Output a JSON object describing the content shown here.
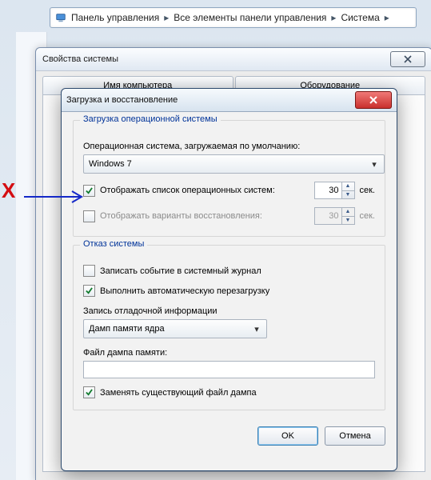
{
  "breadcrumb": {
    "segment1": "Панель управления",
    "segment2": "Все элементы панели управления",
    "segment3": "Система"
  },
  "props_window": {
    "title": "Свойства системы",
    "tabs": [
      "Имя компьютера",
      "Оборудование"
    ]
  },
  "dialog": {
    "title": "Загрузка и восстановление",
    "ok": "OK",
    "cancel": "Отмена",
    "group_boot": {
      "legend": "Загрузка операционной системы",
      "default_os_label": "Операционная система, загружаемая по умолчанию:",
      "default_os_value": "Windows 7",
      "chk_show_os": {
        "checked": true,
        "label": "Отображать список операционных систем:",
        "value": "30",
        "unit": "сек."
      },
      "chk_show_recovery": {
        "checked": false,
        "label": "Отображать варианты восстановления:",
        "value": "30",
        "unit": "сек."
      }
    },
    "group_fail": {
      "legend": "Отказ системы",
      "chk_log": {
        "checked": false,
        "label": "Записать событие в системный журнал"
      },
      "chk_restart": {
        "checked": true,
        "label": "Выполнить автоматическую перезагрузку"
      },
      "dump_label": "Запись отладочной информации",
      "dump_value": "Дамп памяти ядра",
      "dump_file_label": "Файл дампа памяти:",
      "dump_file_value": "",
      "chk_overwrite": {
        "checked": true,
        "label": "Заменять существующий файл дампа"
      }
    }
  },
  "annotation": {
    "x": "X"
  }
}
